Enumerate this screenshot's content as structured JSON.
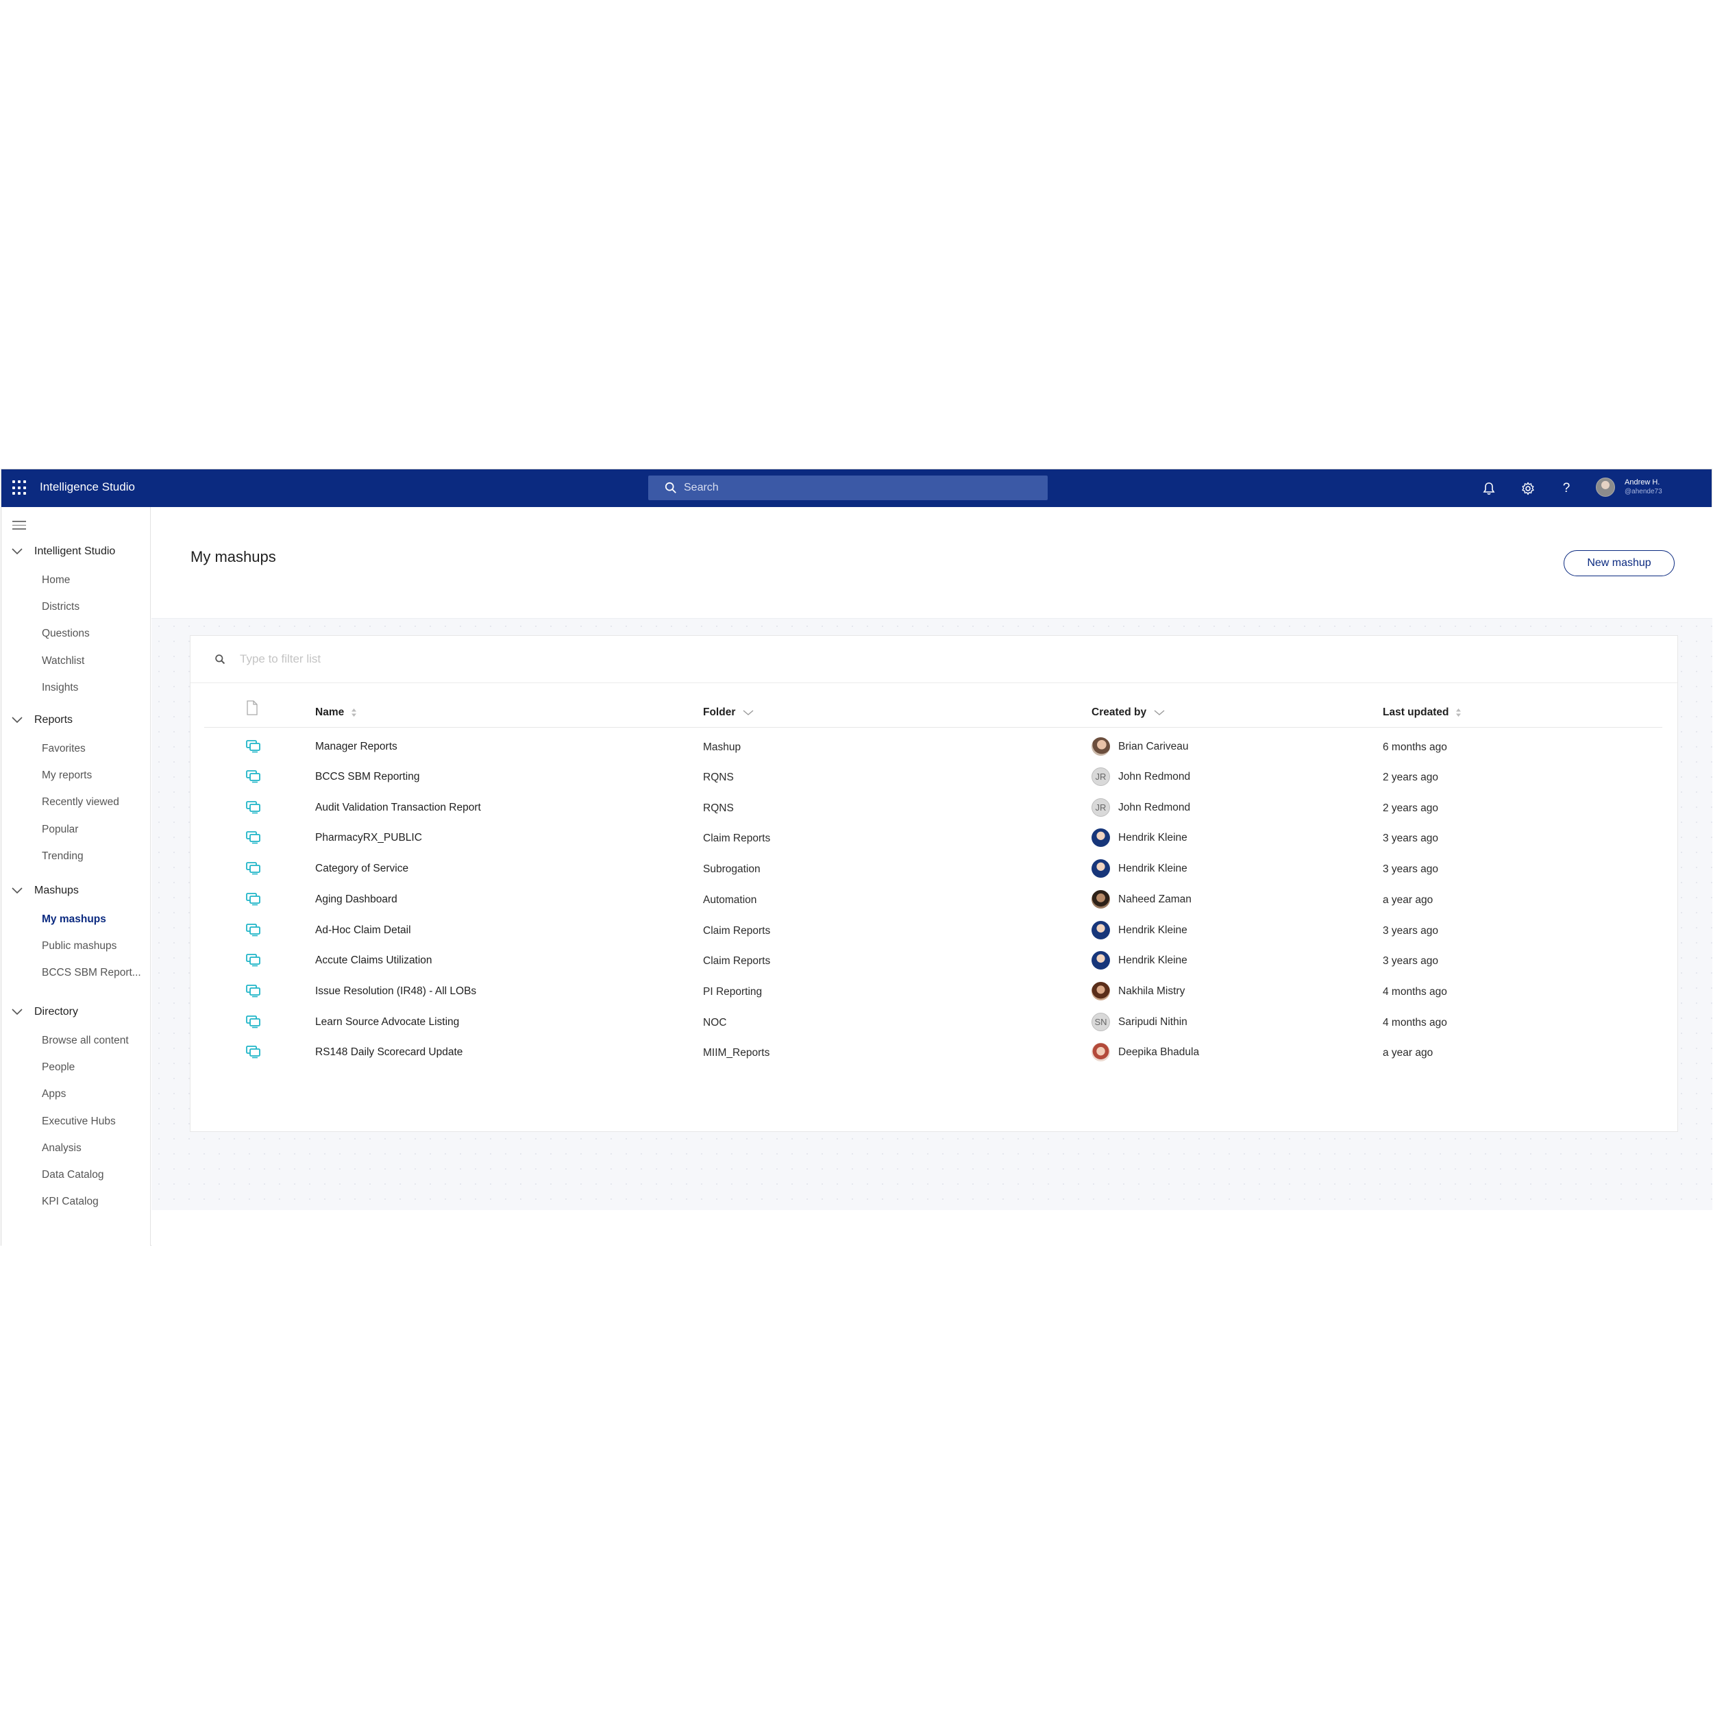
{
  "topbar": {
    "app_title": "Intelligence Studio",
    "search_placeholder": "Search",
    "help_label": "?",
    "user_name": "Andrew H.",
    "user_handle": "@ahende73"
  },
  "sidebar": {
    "sections": [
      {
        "title": "Intelligent Studio",
        "items": [
          "Home",
          "Districts",
          "Questions",
          "Watchlist",
          "Insights"
        ]
      },
      {
        "title": "Reports",
        "items": [
          "Favorites",
          "My reports",
          "Recently viewed",
          "Popular",
          "Trending"
        ]
      },
      {
        "title": "Mashups",
        "items": [
          "My mashups",
          "Public mashups",
          "BCCS SBM Report..."
        ]
      },
      {
        "title": "Directory",
        "items": [
          "Browse all content",
          "People",
          "Apps",
          "Executive Hubs",
          "Analysis",
          "Data Catalog",
          "KPI Catalog"
        ]
      }
    ],
    "active_item": "My mashups"
  },
  "page": {
    "title": "My mashups",
    "new_button": "New mashup",
    "filter_placeholder": "Type to filter list"
  },
  "table": {
    "columns": {
      "name": "Name",
      "folder": "Folder",
      "created_by": "Created by",
      "last_updated": "Last updated"
    },
    "rows": [
      {
        "name": "Manager Reports",
        "folder": "Mashup",
        "created_by": "Brian Cariveau",
        "avatar": "photo-a",
        "initials": "",
        "last_updated": "6 months ago"
      },
      {
        "name": "BCCS SBM Reporting",
        "folder": "RQNS",
        "created_by": "John Redmond",
        "avatar": "initials",
        "initials": "JR",
        "last_updated": "2 years ago"
      },
      {
        "name": "Audit Validation Transaction Report",
        "folder": "RQNS",
        "created_by": "John Redmond",
        "avatar": "initials",
        "initials": "JR",
        "last_updated": "2 years ago"
      },
      {
        "name": "PharmacyRX_PUBLIC",
        "folder": "Claim Reports",
        "created_by": "Hendrik Kleine",
        "avatar": "photo-b",
        "initials": "",
        "last_updated": "3 years ago"
      },
      {
        "name": "Category of Service",
        "folder": "Subrogation",
        "created_by": "Hendrik Kleine",
        "avatar": "photo-b",
        "initials": "",
        "last_updated": "3 years ago"
      },
      {
        "name": "Aging Dashboard",
        "folder": "Automation",
        "created_by": "Naheed Zaman",
        "avatar": "photo-c",
        "initials": "",
        "last_updated": "a year ago"
      },
      {
        "name": "Ad-Hoc Claim Detail",
        "folder": "Claim Reports",
        "created_by": "Hendrik Kleine",
        "avatar": "photo-b",
        "initials": "",
        "last_updated": "3 years ago"
      },
      {
        "name": "Accute Claims Utilization",
        "folder": "Claim Reports",
        "created_by": "Hendrik Kleine",
        "avatar": "photo-b",
        "initials": "",
        "last_updated": "3 years ago"
      },
      {
        "name": "Issue Resolution (IR48) - All LOBs",
        "folder": "PI Reporting",
        "created_by": "Nakhila Mistry",
        "avatar": "photo-d",
        "initials": "",
        "last_updated": "4 months ago"
      },
      {
        "name": "Learn Source Advocate Listing",
        "folder": "NOC",
        "created_by": "Saripudi Nithin",
        "avatar": "initials",
        "initials": "SN",
        "last_updated": "4 months ago"
      },
      {
        "name": "RS148 Daily Scorecard Update",
        "folder": "MIIM_Reports",
        "created_by": "Deepika Bhadula",
        "avatar": "photo-e",
        "initials": "",
        "last_updated": "a year ago"
      }
    ]
  },
  "colors": {
    "brand_navy": "#0b2a80",
    "search_bg": "#3b59a6",
    "mashup_icon": "#1fb5c8"
  },
  "icons": [
    "apps-grid-icon",
    "search-icon",
    "bell-icon",
    "gear-icon",
    "help-icon",
    "menu-icon",
    "chevron-down-icon",
    "document-icon",
    "sort-icon",
    "mashup-icon"
  ]
}
